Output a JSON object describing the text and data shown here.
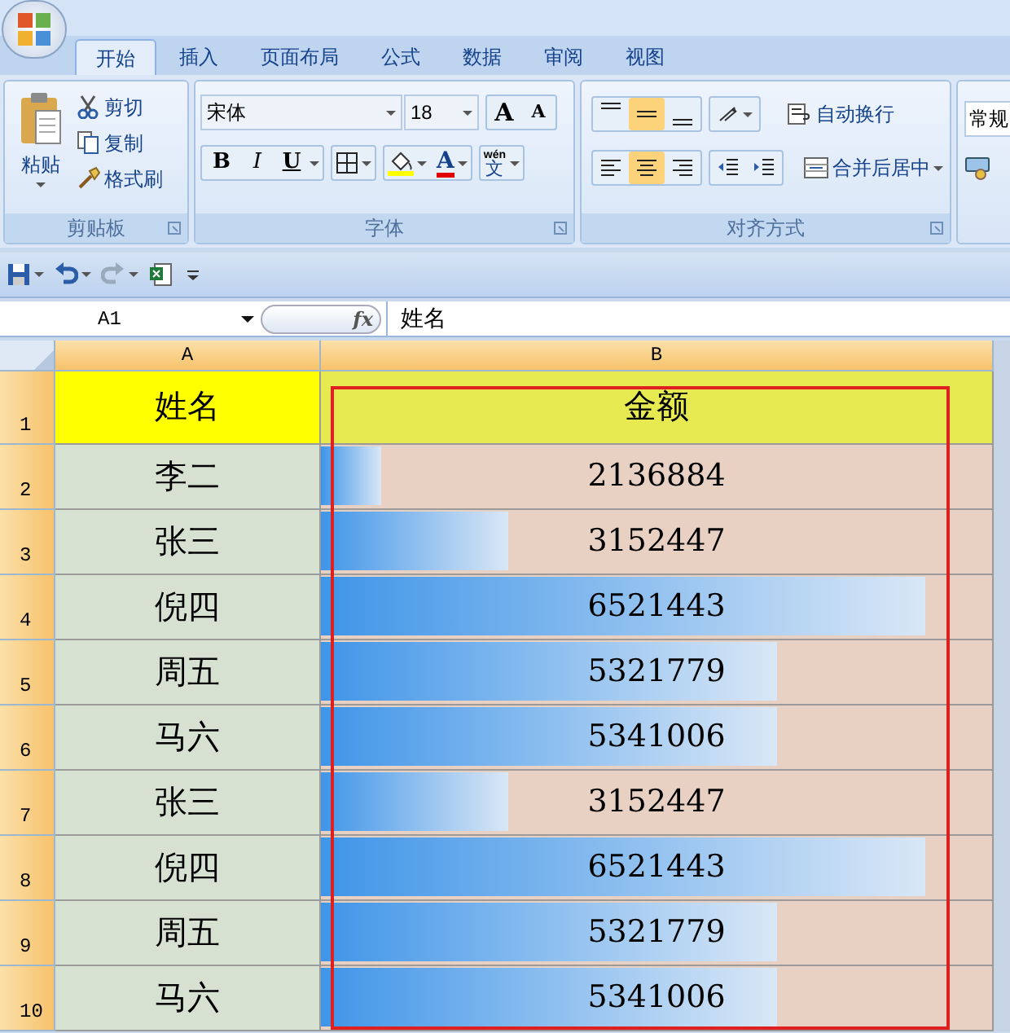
{
  "tabs": [
    {
      "label": "开始",
      "selected": true
    },
    {
      "label": "插入",
      "selected": false
    },
    {
      "label": "页面布局",
      "selected": false
    },
    {
      "label": "公式",
      "selected": false
    },
    {
      "label": "数据",
      "selected": false
    },
    {
      "label": "审阅",
      "selected": false
    },
    {
      "label": "视图",
      "selected": false
    }
  ],
  "clipboard": {
    "paste": "粘贴",
    "cut": "剪切",
    "copy": "复制",
    "format_painter": "格式刷",
    "title": "剪贴板"
  },
  "font": {
    "name": "宋体",
    "size": "18",
    "grow": "A",
    "shrink": "A",
    "bold": "B",
    "italic": "I",
    "underline": "U",
    "font_color": "A",
    "phonetic_ruby": "wén",
    "phonetic_base": "文",
    "title": "字体"
  },
  "alignment": {
    "vertical": [
      {
        "selected": false
      },
      {
        "selected": true
      },
      {
        "selected": false
      }
    ],
    "horizontal": [
      {
        "selected": false
      },
      {
        "selected": true
      },
      {
        "selected": false
      }
    ],
    "wrap_text": "自动换行",
    "merge_center": "合并后居中",
    "title": "对齐方式"
  },
  "number": {
    "format": "常规"
  },
  "formula_bar": {
    "name_box": "A1",
    "fx": "fx",
    "content": "姓名"
  },
  "columns": [
    {
      "label": "A",
      "selected": true
    },
    {
      "label": "B",
      "selected": true
    }
  ],
  "rows": [
    {
      "number": "1",
      "kind": "header",
      "name": "姓名",
      "amount": "金额",
      "selected": true
    },
    {
      "number": "2",
      "kind": "data",
      "name": "李二",
      "amount": "2136884",
      "level": 0.09,
      "selected": true
    },
    {
      "number": "3",
      "kind": "data",
      "name": "张三",
      "amount": "3152447",
      "level": 0.28,
      "selected": true
    },
    {
      "number": "4",
      "kind": "data",
      "name": "倪四",
      "amount": "6521443",
      "level": 0.9,
      "selected": true
    },
    {
      "number": "5",
      "kind": "data",
      "name": "周五",
      "amount": "5321779",
      "level": 0.68,
      "selected": true
    },
    {
      "number": "6",
      "kind": "data",
      "name": "马六",
      "amount": "5341006",
      "level": 0.68,
      "selected": true
    },
    {
      "number": "7",
      "kind": "data",
      "name": "张三",
      "amount": "3152447",
      "level": 0.28,
      "selected": true
    },
    {
      "number": "8",
      "kind": "data",
      "name": "倪四",
      "amount": "6521443",
      "level": 0.9,
      "selected": true
    },
    {
      "number": "9",
      "kind": "data",
      "name": "周五",
      "amount": "5321779",
      "level": 0.68,
      "selected": true
    },
    {
      "number": "10",
      "kind": "data",
      "name": "马六",
      "amount": "5341006",
      "level": 0.68,
      "selected": true
    }
  ]
}
